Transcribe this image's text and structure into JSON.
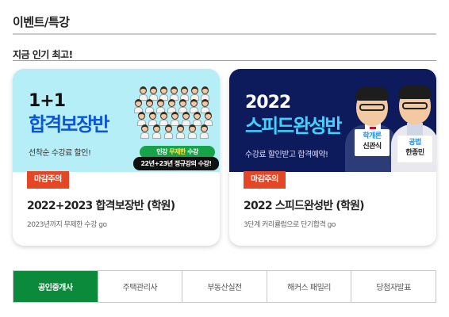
{
  "section": {
    "title": "이벤트/특강",
    "subtitle": "지금 인기 최고!"
  },
  "cards": [
    {
      "banner_pre": "1+1",
      "banner_main": "합격보장반",
      "banner_sub": "선착순 수강료 할인!",
      "pill_green_prefix": "인강 ",
      "pill_green_highlight": "무제한",
      "pill_green_suffix": " 수강",
      "pill_black": "22년+23년 정규강의 수강!",
      "badge": "마감주의",
      "title": "2022+2023 합격보장반 (학원)",
      "desc": "2023년까지 무제한 수강 go",
      "colors": {
        "bg": "#b6eef7",
        "accent": "#0b55d6"
      }
    },
    {
      "banner_pre": "2022",
      "banner_main": "스피드완성반",
      "banner_sub": "수강료 할인받고 합격예약!",
      "instructor1_subject": "학개론",
      "instructor1_name": "신관식",
      "instructor2_subject": "공법",
      "instructor2_name": "한종민",
      "badge": "마감주의",
      "title": "2022 스피드완성반 (학원)",
      "desc": "3단계 커리큘럼으로 단기합격 go",
      "colors": {
        "bg": "#0d1a5c",
        "accent": "#3fd4ff"
      }
    }
  ],
  "tabs": [
    {
      "label": "공인중개사",
      "active": true
    },
    {
      "label": "주택관리사",
      "active": false
    },
    {
      "label": "부동산실전",
      "active": false
    },
    {
      "label": "해커스 패밀리",
      "active": false
    },
    {
      "label": "당첨자발표",
      "active": false
    }
  ],
  "colors": {
    "badge": "#e34726",
    "tab_active": "#0c8a3c"
  }
}
